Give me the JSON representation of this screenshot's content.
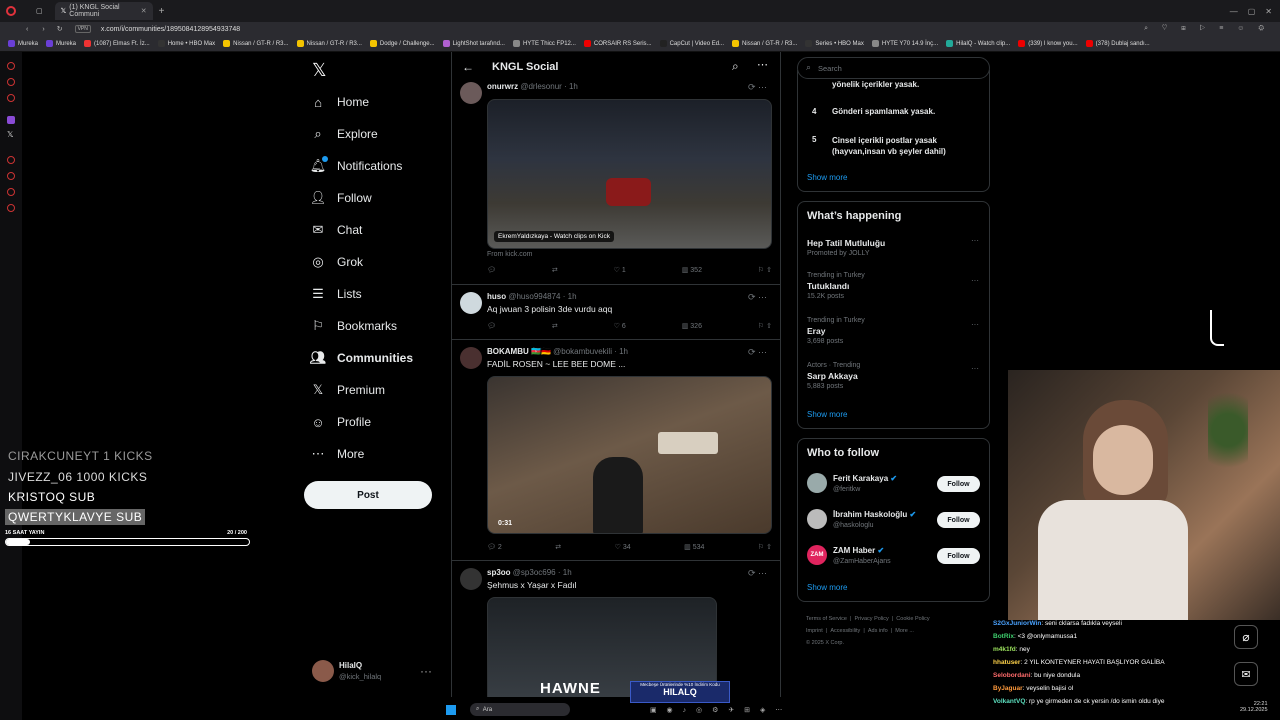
{
  "browser": {
    "tab_title": "(1) KNGL Social Communi",
    "url": "x.com/i/communities/1895084128954933748",
    "vpn": "VPN",
    "bookmarks": [
      "Mureka",
      "Mureka",
      "(1087) Elmas Ft. İz...",
      "Home • HBO Max",
      "Nissan / GT-R / R3...",
      "Nissan / GT-R / R3...",
      "Dodge / Challenge...",
      "LightShot tarafınd...",
      "HYTE Thicc FP12...",
      "CORSAIR RS Seris...",
      "CapCut | Video Ed...",
      "Nissan / GT-R / R3...",
      "Series • HBO Max",
      "HYTE Y70 14.9 İnç...",
      "HilalQ - Watch clip...",
      "(339) I know you...",
      "(378) Dublaj sandı..."
    ]
  },
  "nav": {
    "items": [
      "Home",
      "Explore",
      "Notifications",
      "Follow",
      "Chat",
      "Grok",
      "Lists",
      "Bookmarks",
      "Communities",
      "Premium",
      "Profile",
      "More"
    ],
    "post_label": "Post",
    "account_name": "HilalQ",
    "account_handle": "@kick_hilalq"
  },
  "header": {
    "title": "KNGL Social"
  },
  "tweets": [
    {
      "name": "onurwrz",
      "handle": "@drlesonur",
      "time": "· 1h",
      "text": "",
      "media_caption": "EkremYaldızkaya - Watch clips on Kick",
      "source": "From kick.com",
      "replies": "",
      "retweets": "",
      "likes": "1",
      "views": "352"
    },
    {
      "name": "huso",
      "handle": "@huso994874",
      "time": "· 1h",
      "text": "Aq jwuan 3 polisin 3de vurdu aqq",
      "replies": "",
      "retweets": "",
      "likes": "6",
      "views": "326"
    },
    {
      "name": "BOKAMBU 🇦🇿🇩🇪",
      "handle": "@bokambuvekili",
      "time": "· 1h",
      "text": "FADİL ROSEN ~ LEE BEE DOME ...",
      "duration": "0:31",
      "replies": "2",
      "retweets": "",
      "likes": "34",
      "views": "534"
    },
    {
      "name": "sp3oo",
      "handle": "@sp3oc696",
      "time": "· 1h",
      "text": "Şehmus x Yaşar x Fadıl"
    }
  ],
  "right": {
    "search_placeholder": "Search",
    "rules": [
      {
        "num": "",
        "text": "yönelik içerikler yasak."
      },
      {
        "num": "4",
        "text": "Gönderi spamlamak yasak."
      },
      {
        "num": "5",
        "text": "Cinsel içerikli postlar yasak (hayvan,insan vb şeyler dahil)"
      }
    ],
    "show_more": "Show more",
    "happening_title": "What’s happening",
    "trends": [
      {
        "context": "",
        "title": "Hep Tatil Mutluluğu",
        "meta": "Promoted by JOLLY"
      },
      {
        "context": "Trending in Turkey",
        "title": "Tutuklandı",
        "meta": "15.2K posts"
      },
      {
        "context": "Trending in Turkey",
        "title": "Eray",
        "meta": "3,698 posts"
      },
      {
        "context": "Actors · Trending",
        "title": "Sarp Akkaya",
        "meta": "5,883 posts"
      }
    ],
    "who_title": "Who to follow",
    "follows": [
      {
        "name": "Ferit Karakaya",
        "handle": "@feritkw"
      },
      {
        "name": "İbrahim Haskoloğlu",
        "handle": "@haskologlu"
      },
      {
        "name": "ZAM Haber",
        "handle": "@ZamHaberAjans"
      }
    ],
    "follow_label": "Follow",
    "footer": [
      "Terms of Service",
      "Privacy Policy",
      "Cookie Policy",
      "Imprint",
      "Accessibility",
      "Ads info",
      "More ...",
      "© 2025 X Corp."
    ]
  },
  "stream": {
    "alerts": [
      "CIRAKCUNEYT  1 KICKS",
      "JIVEZZ_06  1000 KICKS",
      "KRISTOQ  SUB",
      "QWERTYKLAVYE  SUB"
    ],
    "goal_label": "16 SAAT YAYIN",
    "goal_value": "20 / 200",
    "goal_progress": 0.1,
    "brand": "HAWNE",
    "promo_line": "Mecbeşe Ürünlerinde %10 İndirim Kodu",
    "promo_code": "HILALQ",
    "chat": [
      {
        "user": "S2GxJuniorWin",
        "msg": ": seni cklarsa fadıkla veyseli"
      },
      {
        "user": "BotRix",
        "msg": ": <3 @onlymamussa1"
      },
      {
        "user": "m4k1fd",
        "msg": ": ney"
      },
      {
        "user": "hhatuser",
        "msg": ": 2 YIL KONTEYNER HAYATI BAŞLIYOR GALİBA"
      },
      {
        "user": "Selobordani",
        "msg": ": bu niye dondula"
      },
      {
        "user": "ByJaguar",
        "msg": ": veyselin bajisi ol"
      },
      {
        "user": "VolkantVQ",
        "msg": ": rp ye girmeden de ck yersin /do ismin oldu diye"
      }
    ]
  },
  "taskbar": {
    "search": "Ara",
    "time": "22:21",
    "date": "29.12.2025"
  }
}
